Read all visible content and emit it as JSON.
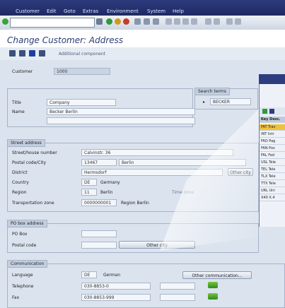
{
  "menu": [
    "Customer",
    "Edit",
    "Goto",
    "Extras",
    "Environment",
    "System",
    "Help"
  ],
  "title": "Change Customer: Address",
  "app_toolbar": {
    "additional_label": "Additional component"
  },
  "customer": {
    "label": "Customer",
    "value": "1000"
  },
  "name_group": {
    "title_label": "Title",
    "title_value": "Company",
    "name_label": "Name",
    "name_value": "Becker Berlin"
  },
  "search_terms": {
    "title": "Search terms",
    "value": "BECKER"
  },
  "street_address": {
    "group_title": "Street address",
    "street_label": "Street/house number",
    "street_value": "Calvinstr. 36",
    "postal_label": "Postal code/City",
    "postal_code": "13467",
    "city": "Berlin",
    "district_label": "District",
    "district_value": "Hermsdorf",
    "country_label": "Country",
    "country_code": "DE",
    "country_name": "Germany",
    "region_label": "Region",
    "region_code": "11",
    "region_name": "Berlin",
    "tz_label": "Transportation zone",
    "tz_value": "0000000001",
    "tz_name": "Region Berlin",
    "other_city_button": "Other city",
    "time_zone": "Time zone"
  },
  "po_box": {
    "group_title": "PO box address",
    "pobox_label": "PO Box",
    "postal_label": "Postal code",
    "other_city_button": "Other city"
  },
  "communication": {
    "group_title": "Communication",
    "language_label": "Language",
    "language_code": "DE",
    "language_name": "German",
    "other_comm_button": "Other communication...",
    "telephone_label": "Telephone",
    "telephone_value": "030-8853-0",
    "fax_label": "Fax",
    "fax_value": "030-8853-999"
  },
  "popup": {
    "header": "Key Desc.",
    "rows": [
      "FAT Trav",
      "INT Intr",
      "FAO Pag",
      "FAN Pos",
      "FAL Fed",
      "USL Tele",
      "TEL Tele",
      "TLX Tele",
      "TTX Tele",
      "URL Uni",
      "X40 X.4"
    ]
  }
}
